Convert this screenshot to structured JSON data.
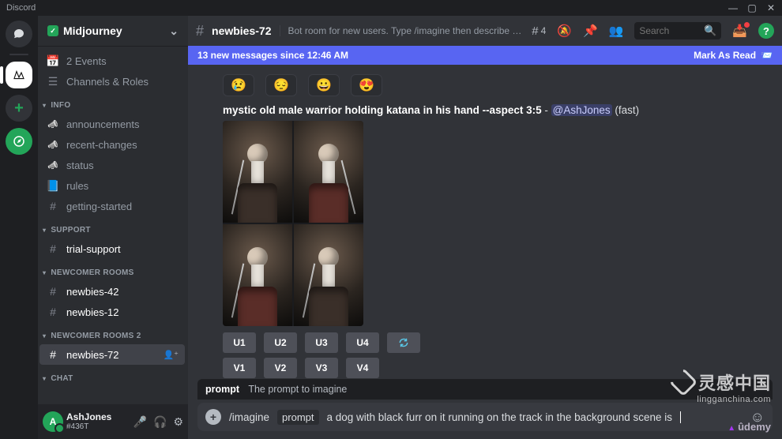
{
  "titlebar": {
    "app": "Discord"
  },
  "server": {
    "name": "Midjourney",
    "events_label": "2 Events",
    "channels_roles_label": "Channels & Roles"
  },
  "sections": {
    "info": "INFO",
    "support": "SUPPORT",
    "newcomer": "NEWCOMER ROOMS",
    "newcomer2": "NEWCOMER ROOMS 2",
    "chat": "CHAT"
  },
  "channels": {
    "announcements": "announcements",
    "recent_changes": "recent-changes",
    "status": "status",
    "rules": "rules",
    "getting_started": "getting-started",
    "trial_support": "trial-support",
    "newbies42": "newbies-42",
    "newbies12": "newbies-12",
    "newbies72": "newbies-72"
  },
  "user": {
    "name": "AshJones",
    "tag": "#436T"
  },
  "header": {
    "channel": "newbies-72",
    "topic": "Bot room for new users. Type /imagine then describe what you want to draw…",
    "thread_count": "4",
    "search_placeholder": "Search"
  },
  "banner": {
    "text": "13 new messages since 12:46 AM",
    "mark": "Mark As Read"
  },
  "message": {
    "prompt_prefix": "mystic old male warrior holding katana in his hand --aspect 3:5",
    "author": "@AshJones",
    "mode": "(fast)",
    "buttons": {
      "u1": "U1",
      "u2": "U2",
      "u3": "U3",
      "u4": "U4",
      "v1": "V1",
      "v2": "V2",
      "v3": "V3",
      "v4": "V4"
    }
  },
  "prompt_hint": {
    "label": "prompt",
    "desc": "The prompt to imagine"
  },
  "input": {
    "command": "/imagine",
    "arg": "prompt",
    "value": "a dog with black furr on it running on the track in the background scene is"
  },
  "watermark": {
    "big": "灵感中国",
    "small": "lingganchina.com"
  },
  "udemy": "ûdemy"
}
